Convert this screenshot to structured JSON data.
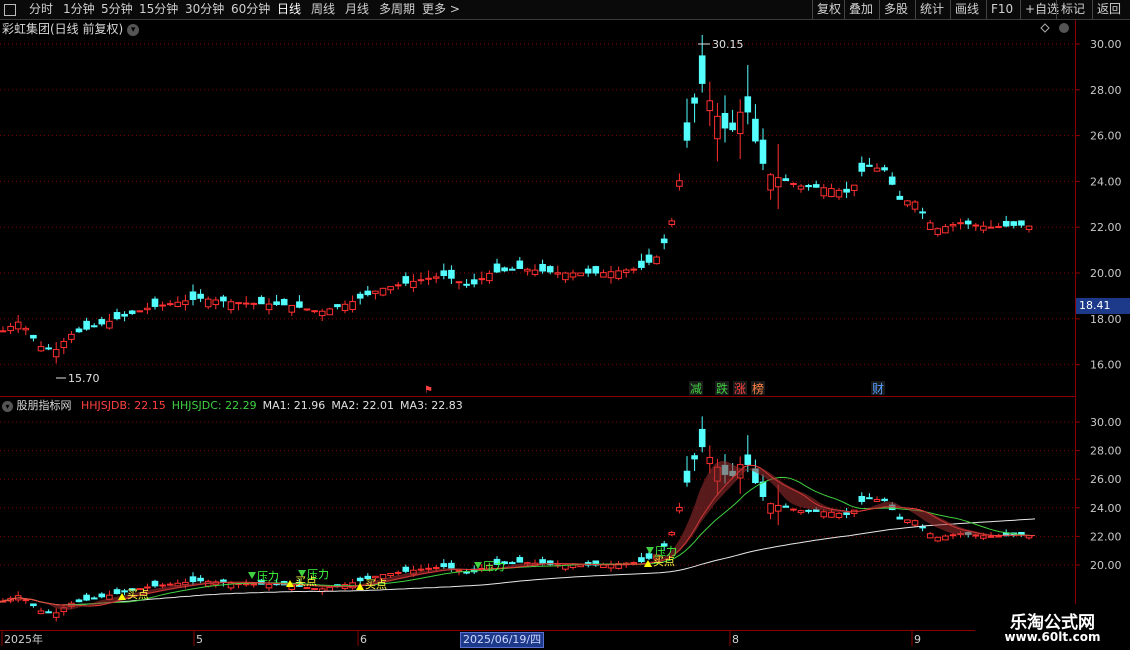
{
  "toolbar": {
    "periods": [
      "分时",
      "1分钟",
      "5分钟",
      "15分钟",
      "30分钟",
      "60分钟",
      "日线",
      "周线",
      "月线",
      "多周期",
      "更多 >"
    ],
    "active_period": "日线",
    "actions": [
      "复权",
      "叠加",
      "多股",
      "统计",
      "画线",
      "F10",
      "+自选",
      "标记",
      "返回"
    ]
  },
  "main_chart": {
    "title": "彩虹集团(日线 前复权)",
    "max_label": "30.15",
    "min_label": "15.70",
    "current_price": "18.41",
    "y_ticks": [
      "30.00",
      "28.00",
      "26.00",
      "24.00",
      "22.00",
      "20.00",
      "18.00",
      "16.00"
    ],
    "event_markers": [
      "减",
      "跌",
      "涨",
      "榜",
      "财"
    ]
  },
  "indicator": {
    "name": "股朋指标网",
    "params": [
      {
        "label": "HHJSJDB: 22.15",
        "color": "#ff4040"
      },
      {
        "label": "HHJSJDC: 22.29",
        "color": "#40d040"
      },
      {
        "label": "MA1: 21.96",
        "color": "#e0e0e0"
      },
      {
        "label": "MA2: 22.01",
        "color": "#e0e0e0"
      },
      {
        "label": "MA3: 22.83",
        "color": "#e0e0e0"
      }
    ],
    "y_ticks": [
      "30.00",
      "28.00",
      "26.00",
      "24.00",
      "22.00",
      "20.00"
    ],
    "signals": [
      "压力",
      "压力",
      "压力",
      "压力",
      "买点",
      "买点",
      "买点",
      "买点"
    ]
  },
  "x_axis": {
    "labels": [
      "2025年",
      "5",
      "6",
      "8",
      "9"
    ],
    "cursor_date": "2025/06/19/四"
  },
  "watermark": {
    "line1": "乐淘公式网",
    "line2": "www.60lt.com"
  },
  "colors": {
    "up": "#ff3030",
    "down": "#54ffff",
    "grid": "#8b0000",
    "bg": "#000000"
  }
}
